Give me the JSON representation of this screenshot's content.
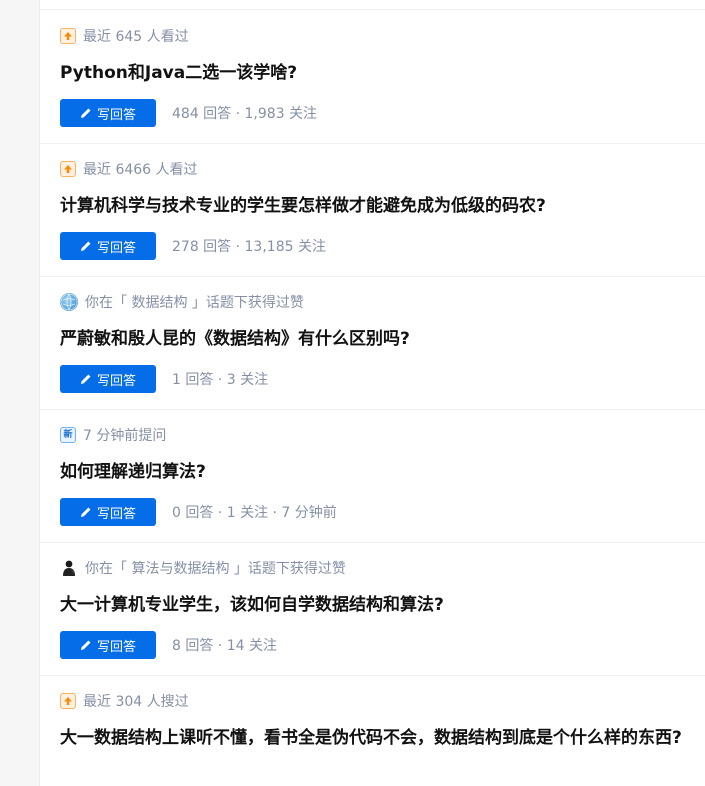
{
  "feed": {
    "button_label": "写回答",
    "items": [
      {
        "icon": "trending-up-icon",
        "meta": "最近 645 人看过",
        "title": "Python和Java二选一该学啥?",
        "stats": "484 回答 · 1,983 关注"
      },
      {
        "icon": "trending-up-icon",
        "meta": "最近 6466 人看过",
        "title": "计算机科学与技术专业的学生要怎样做才能避免成为低级的码农?",
        "stats": "278 回答 · 13,185 关注"
      },
      {
        "icon": "topic-avatar-icon",
        "meta": "你在「 数据结构 」话题下获得过赞",
        "title": "严蔚敏和殷人昆的《数据结构》有什么区别吗?",
        "stats": "1 回答 · 3 关注"
      },
      {
        "icon": "new-badge-icon",
        "meta": "7 分钟前提问",
        "title": "如何理解递归算法?",
        "stats": "0 回答 · 1 关注 · 7 分钟前"
      },
      {
        "icon": "person-avatar-icon",
        "meta": "你在「 算法与数据结构 」话题下获得过赞",
        "title": "大一计算机专业学生，该如何自学数据结构和算法?",
        "stats": "8 回答 · 14 关注"
      },
      {
        "icon": "trending-up-icon",
        "meta": "最近 304 人搜过",
        "title": "大一数据结构上课听不懂，看书全是伪代码不会，数据结构到底是个什么样的东西?"
      }
    ]
  },
  "colors": {
    "button": "#056de8",
    "meta_text": "#8590a6",
    "title_text": "#121212",
    "trending_border": "#f7b160"
  }
}
